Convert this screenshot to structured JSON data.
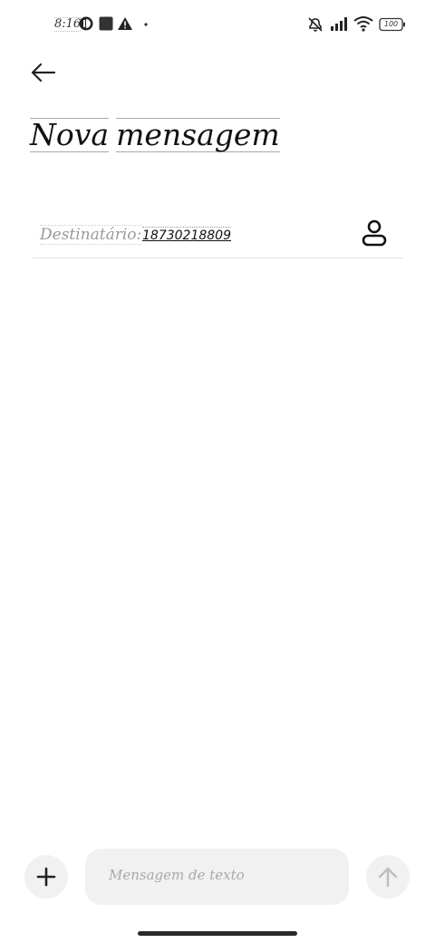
{
  "status_bar": {
    "time": "8:16",
    "battery": "100",
    "icons": [
      "app-icon",
      "square-icon",
      "warning-icon",
      "dot-icon",
      "mute-icon",
      "signal-icon",
      "wifi-icon",
      "battery-icon"
    ]
  },
  "header": {
    "back_icon": "arrow-left-icon",
    "title_word_1": "Nova",
    "title_word_2": "mensagem"
  },
  "recipient": {
    "label": "Destinatário:",
    "value": "18730218809",
    "contact_icon": "person-icon"
  },
  "composer": {
    "attach_icon": "plus-icon",
    "placeholder": "Mensagem de texto",
    "value": "",
    "send_icon": "arrow-up-icon"
  },
  "colors": {
    "background": "#ffffff",
    "input_background": "#f1f1f1",
    "placeholder": "#a8a8a8",
    "divider": "#e3e3e3"
  }
}
